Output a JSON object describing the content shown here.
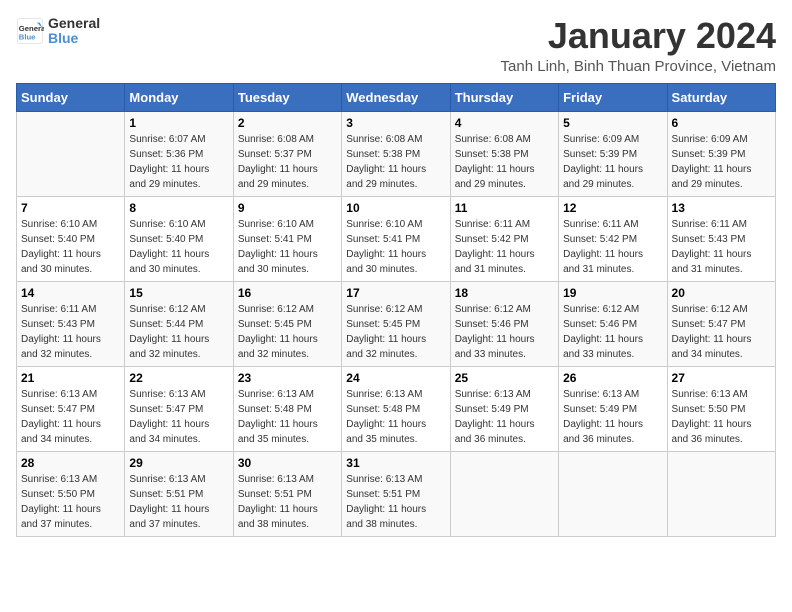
{
  "logo": {
    "line1": "General",
    "line2": "Blue"
  },
  "title": "January 2024",
  "subtitle": "Tanh Linh, Binh Thuan Province, Vietnam",
  "headers": [
    "Sunday",
    "Monday",
    "Tuesday",
    "Wednesday",
    "Thursday",
    "Friday",
    "Saturday"
  ],
  "weeks": [
    [
      {
        "day": "",
        "info": ""
      },
      {
        "day": "1",
        "info": "Sunrise: 6:07 AM\nSunset: 5:36 PM\nDaylight: 11 hours\nand 29 minutes."
      },
      {
        "day": "2",
        "info": "Sunrise: 6:08 AM\nSunset: 5:37 PM\nDaylight: 11 hours\nand 29 minutes."
      },
      {
        "day": "3",
        "info": "Sunrise: 6:08 AM\nSunset: 5:38 PM\nDaylight: 11 hours\nand 29 minutes."
      },
      {
        "day": "4",
        "info": "Sunrise: 6:08 AM\nSunset: 5:38 PM\nDaylight: 11 hours\nand 29 minutes."
      },
      {
        "day": "5",
        "info": "Sunrise: 6:09 AM\nSunset: 5:39 PM\nDaylight: 11 hours\nand 29 minutes."
      },
      {
        "day": "6",
        "info": "Sunrise: 6:09 AM\nSunset: 5:39 PM\nDaylight: 11 hours\nand 29 minutes."
      }
    ],
    [
      {
        "day": "7",
        "info": "Sunrise: 6:10 AM\nSunset: 5:40 PM\nDaylight: 11 hours\nand 30 minutes."
      },
      {
        "day": "8",
        "info": "Sunrise: 6:10 AM\nSunset: 5:40 PM\nDaylight: 11 hours\nand 30 minutes."
      },
      {
        "day": "9",
        "info": "Sunrise: 6:10 AM\nSunset: 5:41 PM\nDaylight: 11 hours\nand 30 minutes."
      },
      {
        "day": "10",
        "info": "Sunrise: 6:10 AM\nSunset: 5:41 PM\nDaylight: 11 hours\nand 30 minutes."
      },
      {
        "day": "11",
        "info": "Sunrise: 6:11 AM\nSunset: 5:42 PM\nDaylight: 11 hours\nand 31 minutes."
      },
      {
        "day": "12",
        "info": "Sunrise: 6:11 AM\nSunset: 5:42 PM\nDaylight: 11 hours\nand 31 minutes."
      },
      {
        "day": "13",
        "info": "Sunrise: 6:11 AM\nSunset: 5:43 PM\nDaylight: 11 hours\nand 31 minutes."
      }
    ],
    [
      {
        "day": "14",
        "info": "Sunrise: 6:11 AM\nSunset: 5:43 PM\nDaylight: 11 hours\nand 32 minutes."
      },
      {
        "day": "15",
        "info": "Sunrise: 6:12 AM\nSunset: 5:44 PM\nDaylight: 11 hours\nand 32 minutes."
      },
      {
        "day": "16",
        "info": "Sunrise: 6:12 AM\nSunset: 5:45 PM\nDaylight: 11 hours\nand 32 minutes."
      },
      {
        "day": "17",
        "info": "Sunrise: 6:12 AM\nSunset: 5:45 PM\nDaylight: 11 hours\nand 32 minutes."
      },
      {
        "day": "18",
        "info": "Sunrise: 6:12 AM\nSunset: 5:46 PM\nDaylight: 11 hours\nand 33 minutes."
      },
      {
        "day": "19",
        "info": "Sunrise: 6:12 AM\nSunset: 5:46 PM\nDaylight: 11 hours\nand 33 minutes."
      },
      {
        "day": "20",
        "info": "Sunrise: 6:12 AM\nSunset: 5:47 PM\nDaylight: 11 hours\nand 34 minutes."
      }
    ],
    [
      {
        "day": "21",
        "info": "Sunrise: 6:13 AM\nSunset: 5:47 PM\nDaylight: 11 hours\nand 34 minutes."
      },
      {
        "day": "22",
        "info": "Sunrise: 6:13 AM\nSunset: 5:47 PM\nDaylight: 11 hours\nand 34 minutes."
      },
      {
        "day": "23",
        "info": "Sunrise: 6:13 AM\nSunset: 5:48 PM\nDaylight: 11 hours\nand 35 minutes."
      },
      {
        "day": "24",
        "info": "Sunrise: 6:13 AM\nSunset: 5:48 PM\nDaylight: 11 hours\nand 35 minutes."
      },
      {
        "day": "25",
        "info": "Sunrise: 6:13 AM\nSunset: 5:49 PM\nDaylight: 11 hours\nand 36 minutes."
      },
      {
        "day": "26",
        "info": "Sunrise: 6:13 AM\nSunset: 5:49 PM\nDaylight: 11 hours\nand 36 minutes."
      },
      {
        "day": "27",
        "info": "Sunrise: 6:13 AM\nSunset: 5:50 PM\nDaylight: 11 hours\nand 36 minutes."
      }
    ],
    [
      {
        "day": "28",
        "info": "Sunrise: 6:13 AM\nSunset: 5:50 PM\nDaylight: 11 hours\nand 37 minutes."
      },
      {
        "day": "29",
        "info": "Sunrise: 6:13 AM\nSunset: 5:51 PM\nDaylight: 11 hours\nand 37 minutes."
      },
      {
        "day": "30",
        "info": "Sunrise: 6:13 AM\nSunset: 5:51 PM\nDaylight: 11 hours\nand 38 minutes."
      },
      {
        "day": "31",
        "info": "Sunrise: 6:13 AM\nSunset: 5:51 PM\nDaylight: 11 hours\nand 38 minutes."
      },
      {
        "day": "",
        "info": ""
      },
      {
        "day": "",
        "info": ""
      },
      {
        "day": "",
        "info": ""
      }
    ]
  ]
}
